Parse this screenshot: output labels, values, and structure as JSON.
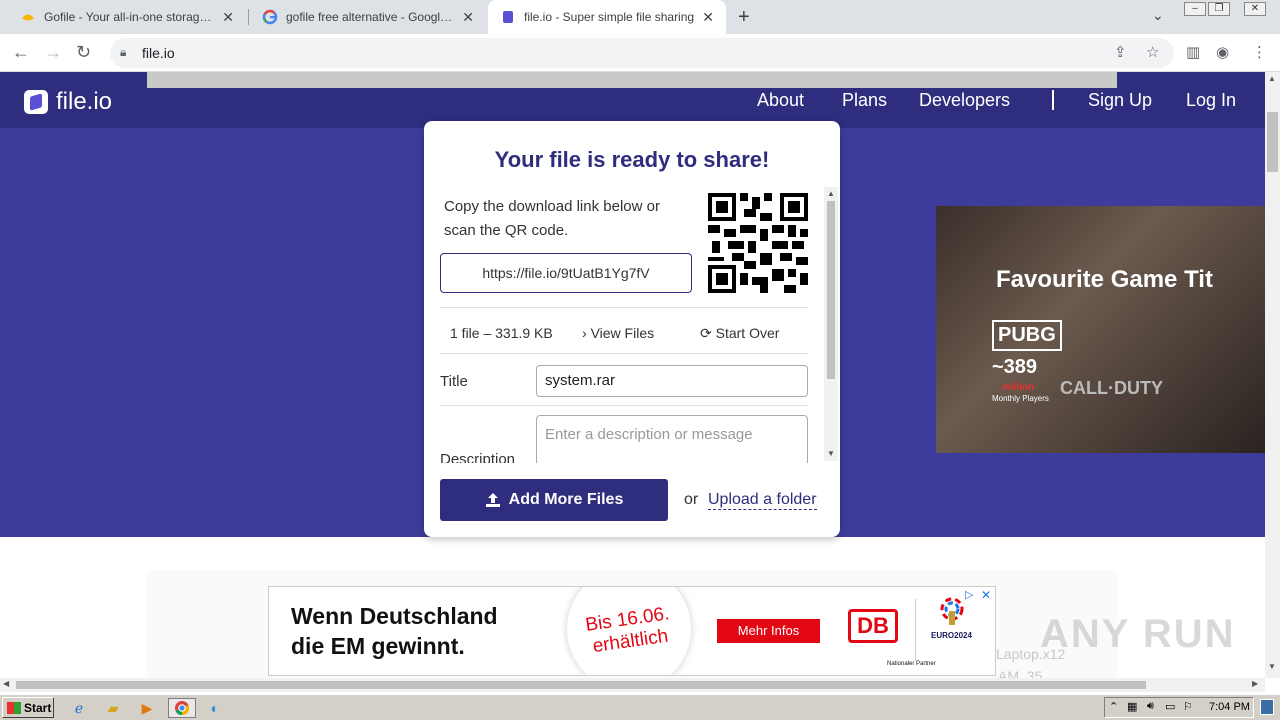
{
  "browser": {
    "tabs": [
      {
        "title": "Gofile - Your all-in-one storage soluti",
        "active": false
      },
      {
        "title": "gofile free alternative - Google Sudh",
        "active": false
      },
      {
        "title": "file.io - Super simple file sharing",
        "active": true
      }
    ],
    "new_tab": "+",
    "url": "file.io"
  },
  "site": {
    "logo_text": "file.io",
    "nav": [
      "About",
      "Plans",
      "Developers",
      "Sign Up",
      "Log In"
    ]
  },
  "card": {
    "title": "Your file is ready to share!",
    "copy_text": "Copy the download link below or scan the QR code.",
    "link": "https://file.io/9tUatB1Yg7fV",
    "file_info": "1 file – 331.9 KB",
    "view_files": "View Files",
    "start_over": "Start Over",
    "title_label": "Title",
    "title_value": "system.rar",
    "description_label": "Description",
    "description_placeholder": "Enter a description or message",
    "add_more_files": "Add More Files",
    "or": "or",
    "upload_folder": "Upload a folder"
  },
  "ad_right": {
    "headline": "Favourite Game Tit",
    "pubg": "PUBG",
    "number": "~389",
    "million": "million",
    "monthly": "Monthly Players",
    "cod": "CALL·DUTY"
  },
  "ad_bottom": {
    "headline_line1": "Wenn Deutschland",
    "headline_line2": "die EM gewinnt.",
    "circle_text": "Bis 16.06. erhältlich",
    "button": "Mehr Infos",
    "brand": "DB",
    "euro": "EURO2024",
    "partner": "Nationaler Partner"
  },
  "watermark": "ANY RUN",
  "ghost_text": [
    "Laptop.x12",
    "AM_35"
  ],
  "taskbar": {
    "start": "Start",
    "clock": "7:04 PM"
  },
  "colors": {
    "hero": "#3d3c9c",
    "navbar": "#2f2d7d",
    "accent": "#2f2d7d"
  }
}
